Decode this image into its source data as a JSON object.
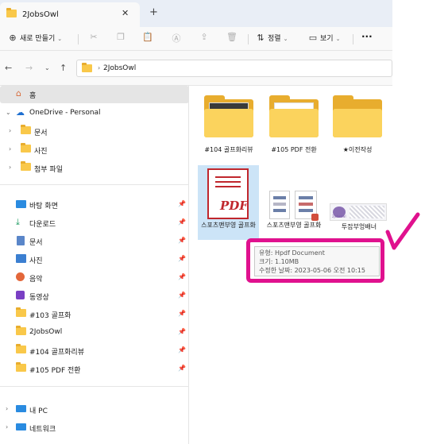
{
  "window": {
    "tab_title": "2JobsOwl",
    "new_tab": "+",
    "tab_close": "✕"
  },
  "toolbar": {
    "new_label": "새로 만들기",
    "sort_label": "정렬",
    "view_label": "보기",
    "more_label": "···"
  },
  "address": {
    "crumb": "2JobsOwl"
  },
  "sidebar": {
    "home": "홈",
    "onedrive": "OneDrive - Personal",
    "onedrive_children": [
      "문서",
      "사진",
      "첨부 파일"
    ],
    "quick_access": [
      "바탕 화면",
      "다운로드",
      "문서",
      "사진",
      "음악",
      "동영상",
      "#103 골프화",
      "2JobsOwl",
      "#104 골프화리뷰",
      "#105 PDF 전환"
    ],
    "this_pc": "내 PC",
    "network": "네트워크"
  },
  "content": {
    "items": [
      {
        "name": "#104 골프화리뷰"
      },
      {
        "name": "#105 PDF 전환"
      },
      {
        "name": "★이전작성"
      },
      {
        "name": "스포츠맨부영 골프화"
      },
      {
        "name": "스포츠맨부영 골프화"
      },
      {
        "name": "투잡부엉배너"
      }
    ],
    "pdf_icon_text": "PDF",
    "banner_logo": "2jobsowl"
  },
  "tooltip": {
    "type": "유형: Hpdf Document",
    "size": "크기: 1.10MB",
    "modified": "수정한 날짜: 2023-05-06 오전 10:15"
  },
  "colors": {
    "folder": "#f9c84a",
    "highlight": "#e0118e",
    "selection": "#cce4f7"
  }
}
